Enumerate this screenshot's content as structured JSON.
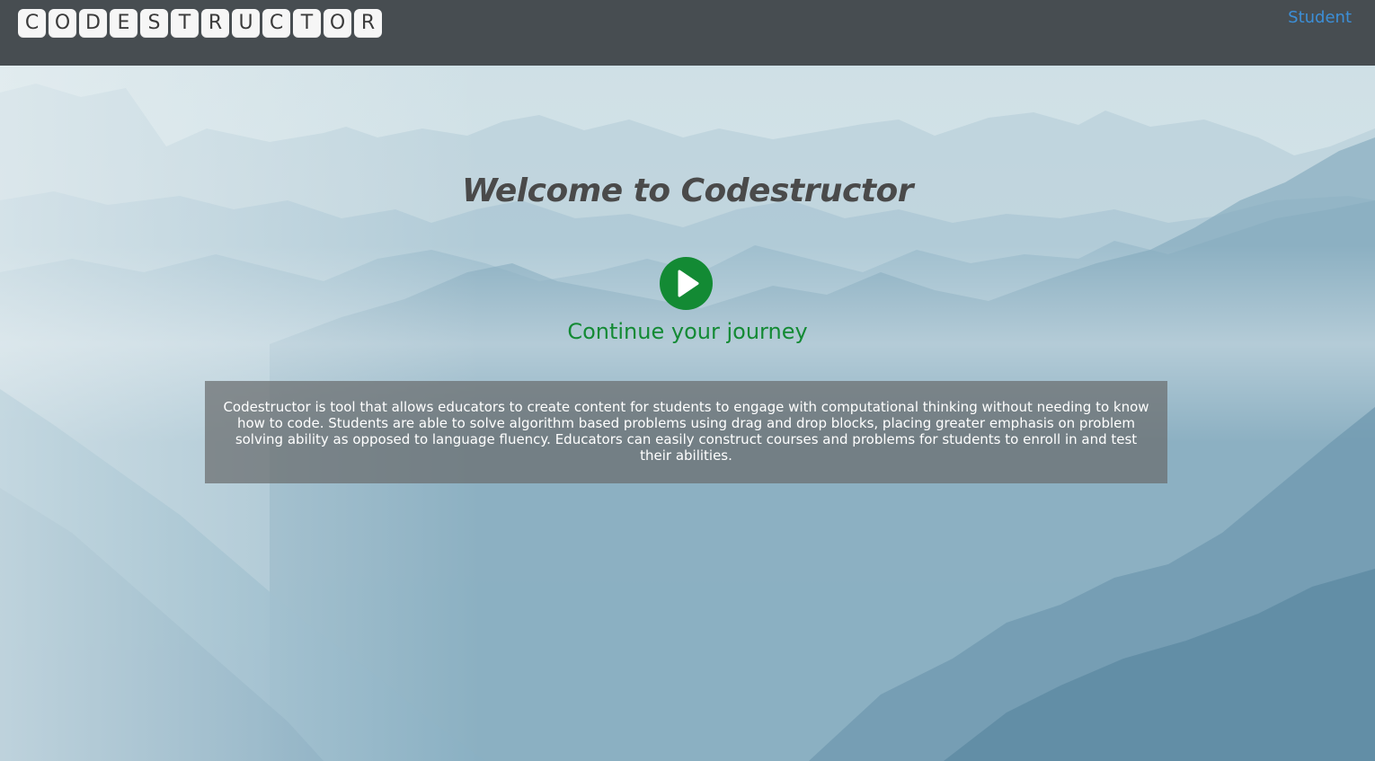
{
  "header": {
    "logo_letters": [
      "C",
      "O",
      "D",
      "E",
      "S",
      "T",
      "R",
      "U",
      "C",
      "T",
      "O",
      "R"
    ],
    "nav_student": "Student"
  },
  "hero": {
    "title": "Welcome to Codestructor",
    "play_icon": "play-circle-icon",
    "continue_label": "Continue your journey",
    "description": "Codestructor is tool that allows educators to create content for students to engage with computational thinking without needing to know how to code. Students are able to solve algorithm based problems using drag and drop blocks, placing greater emphasis on problem solving ability as opposed to language fluency. Educators can easily construct courses and problems for students to enroll in and test their abilities."
  },
  "colors": {
    "header_bg": "#474d51",
    "accent_green": "#138a34",
    "link_blue": "#3c8fd8",
    "title_text": "#4a4a4a"
  }
}
